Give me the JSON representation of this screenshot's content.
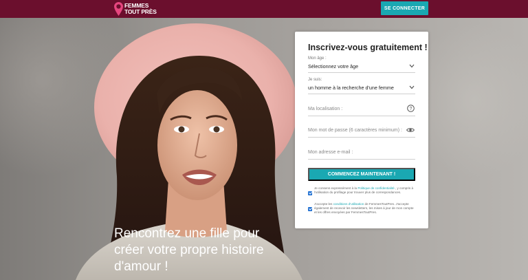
{
  "brand": {
    "line1": "FEMMES",
    "line2": "TOUT PRÈS",
    "pin_color": "#e6467f"
  },
  "header": {
    "login_label": "SE CONNECTER",
    "background": "#6b0f2d"
  },
  "hero": {
    "headline": [
      "Rencontrez une fille pour",
      "créer votre propre histoire",
      "d'amour !"
    ]
  },
  "form": {
    "title": "Inscrivez-vous gratuitement !",
    "age": {
      "label": "Mon âge :",
      "value": "Sélectionnez votre âge",
      "icon": "chevron-down-icon"
    },
    "iam": {
      "label": "Je suis:",
      "value": "un homme à la recherche d'une femme",
      "icon": "chevron-down-icon"
    },
    "location": {
      "placeholder": "Ma localisation :",
      "icon": "help-icon"
    },
    "password": {
      "placeholder": "Mon mot de passe (6 caractères minimum) :",
      "icon": "eye-icon"
    },
    "email": {
      "placeholder": "Mon adresse e-mail :"
    },
    "submit_label": "COMMENCEZ MAINTENANT !",
    "consent1": {
      "pre": "Je consens expressément à la ",
      "link": "Politique de confidentialité",
      "post": " , y compris à l'utilisation du profilage pour trouver plus de correspondances."
    },
    "consent2": {
      "pre": "J'accepte les ",
      "link": "conditions d'utilisation",
      "post": " de FemmesToutPres. J'accepte également de recevoir les newsletters, les mises à jour de mon compte et les offres envoyées par FemmesToutPres."
    },
    "accent": "#1aa8b2"
  }
}
